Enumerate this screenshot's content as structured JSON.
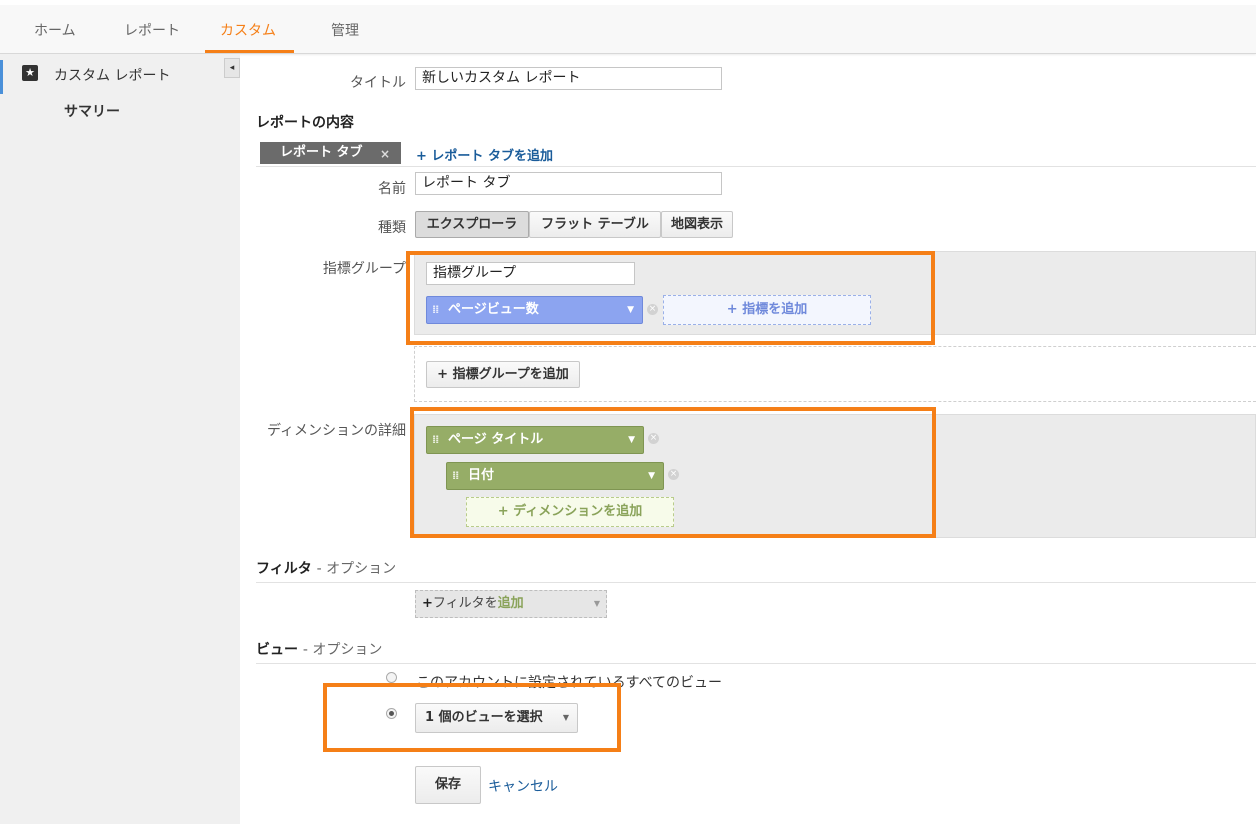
{
  "nav": {
    "tabs": [
      {
        "label": "ホーム"
      },
      {
        "label": "レポート"
      },
      {
        "label": "カスタム"
      },
      {
        "label": "管理"
      }
    ]
  },
  "sidebar": {
    "item_label": "カスタム レポート",
    "sub_item_label": "サマリー",
    "collapse_icon": "◂"
  },
  "form": {
    "title_label": "タイトル",
    "title_value": "新しいカスタム レポート",
    "content_heading": "レポートの内容",
    "tab_chip_label": "レポート タブ",
    "tab_chip_close": "×",
    "add_tab_link": "+ レポート タブを追加",
    "name_label": "名前",
    "name_value": "レポート タブ",
    "type_label": "種類",
    "type_options": [
      "エクスプローラ",
      "フラット テーブル",
      "地図表示"
    ],
    "metric_group_label": "指標グループ",
    "metric_group_name": "指標グループ",
    "metric_chip": "ページビュー数",
    "add_metric": "+ 指標を追加",
    "add_metric_group": "+ 指標グループを追加",
    "dimension_label": "ディメンションの詳細",
    "dimension_chips": [
      "ページ タイトル",
      "日付"
    ],
    "add_dimension": "+ ディメンションを追加",
    "filter_heading": "フィルタ",
    "filter_option": "- オプション",
    "add_filter_prefix": "+",
    "add_filter_text": "フィルタを",
    "add_filter_highlight": "追加",
    "view_heading": "ビュー",
    "view_option": "- オプション",
    "view_radio_all": "このアカウントに設定されているすべてのビュー",
    "view_radio_one": "1 個のビューを選択",
    "save_button": "保存",
    "cancel_link": "キャンセル"
  },
  "colors": {
    "accent_orange": "#f57f17",
    "metric_blue": "#8ca4f0",
    "dimension_green": "#96ad67",
    "link_blue": "#1a5c9a"
  },
  "selected_type_index": 0,
  "selected_view_option": "one"
}
